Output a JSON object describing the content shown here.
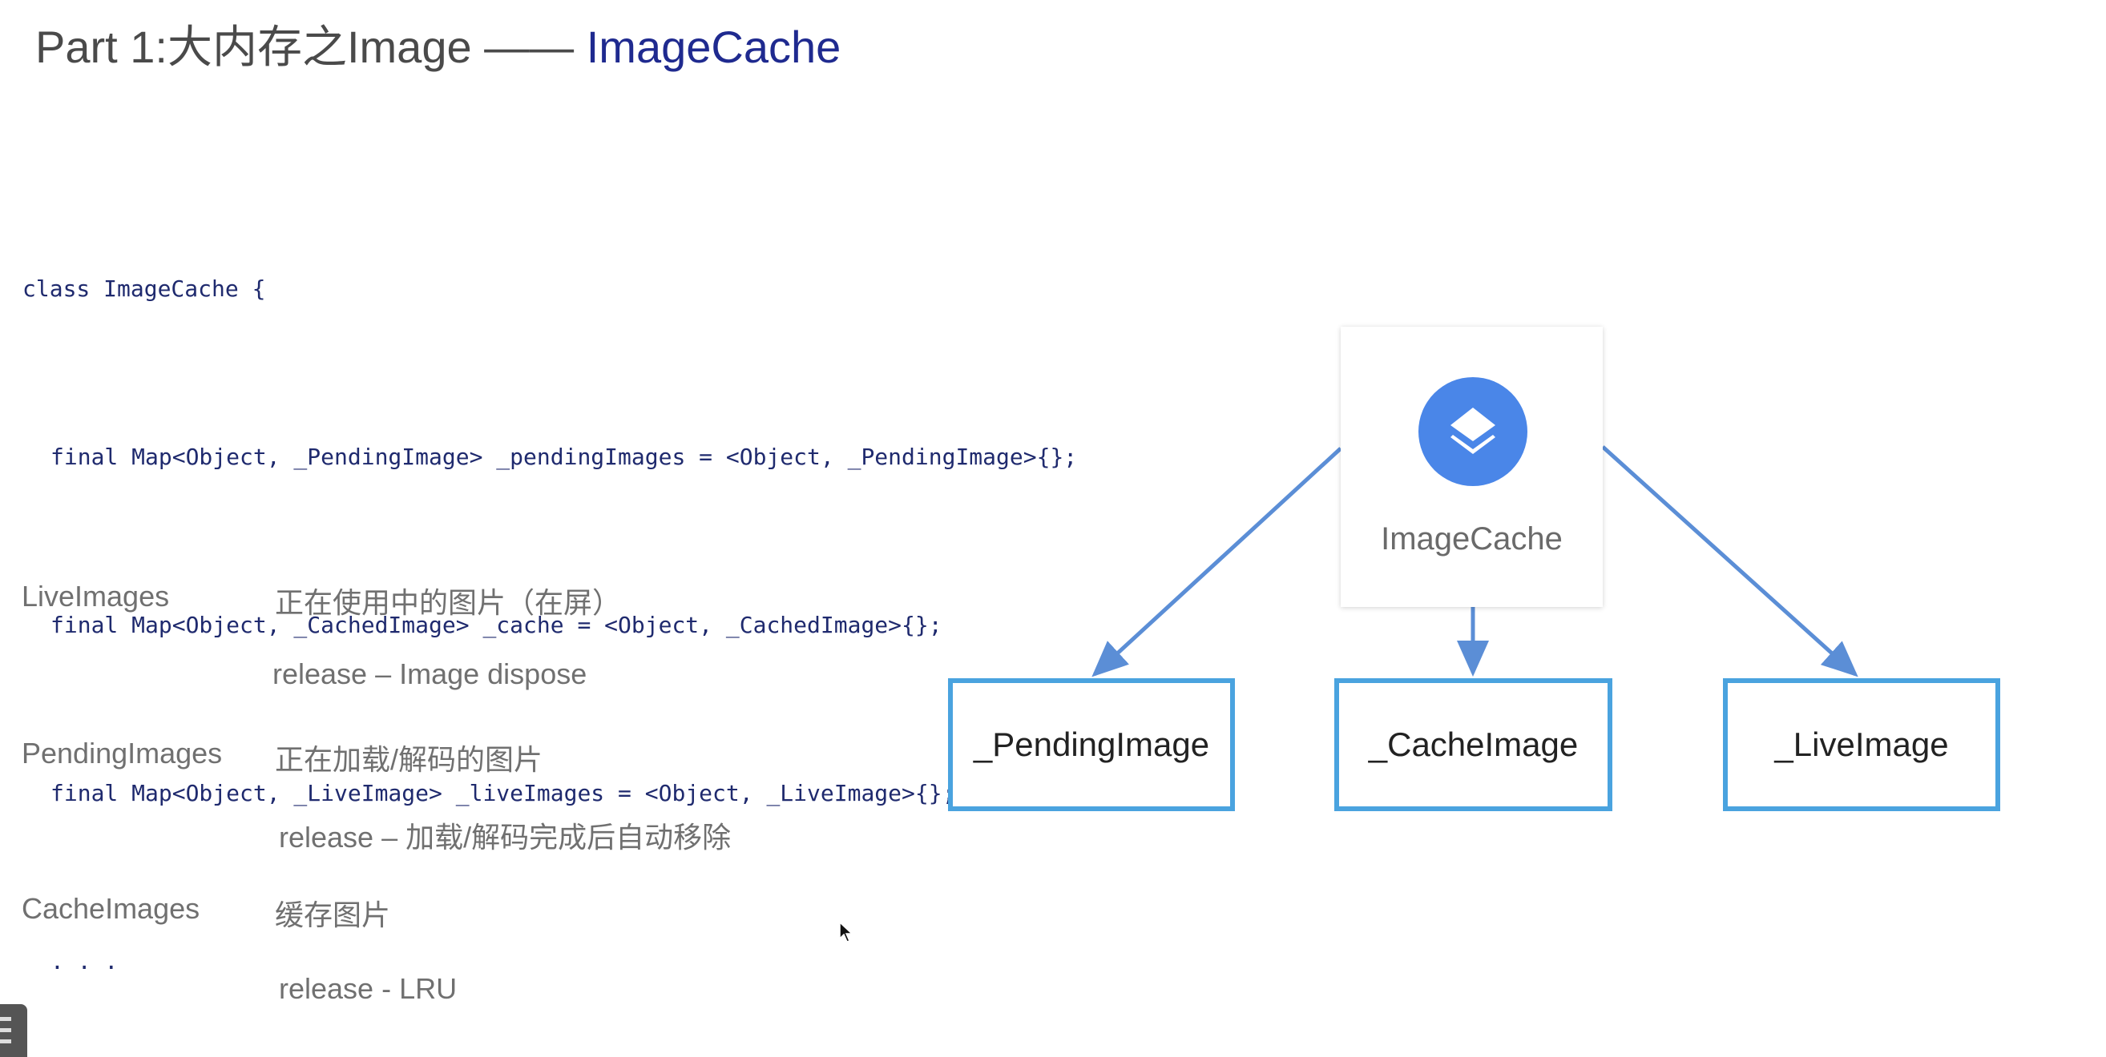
{
  "title": {
    "prefix": "Part 1:大内存之Image —— ",
    "accent": "ImageCache"
  },
  "code": [
    "class ImageCache {",
    "final Map<Object, _PendingImage> _pendingImages = <Object, _PendingImage>{};",
    "final Map<Object, _CachedImage> _cache = <Object, _CachedImage>{};",
    "final Map<Object, _LiveImage> _liveImages = <Object, _LiveImage>{};",
    ". . ."
  ],
  "notes": [
    {
      "label": "LiveImages",
      "desc": "正在使用中的图片（在屏）",
      "release": "release – Image dispose"
    },
    {
      "label": "PendingImages",
      "desc": "正在加载/解码的图片",
      "release": "release – 加载/解码完成后自动移除"
    },
    {
      "label": "CacheImages",
      "desc": "缓存图片",
      "release": "release - LRU"
    }
  ],
  "diagram": {
    "root": {
      "label": "ImageCache",
      "icon": "layers-icon",
      "icon_color": "#4a86e8"
    },
    "children": [
      "_PendingImage",
      "_CacheImage",
      "_LiveImage"
    ],
    "node_border_color": "#4aa3df",
    "arrow_color": "#5b8ed6"
  }
}
